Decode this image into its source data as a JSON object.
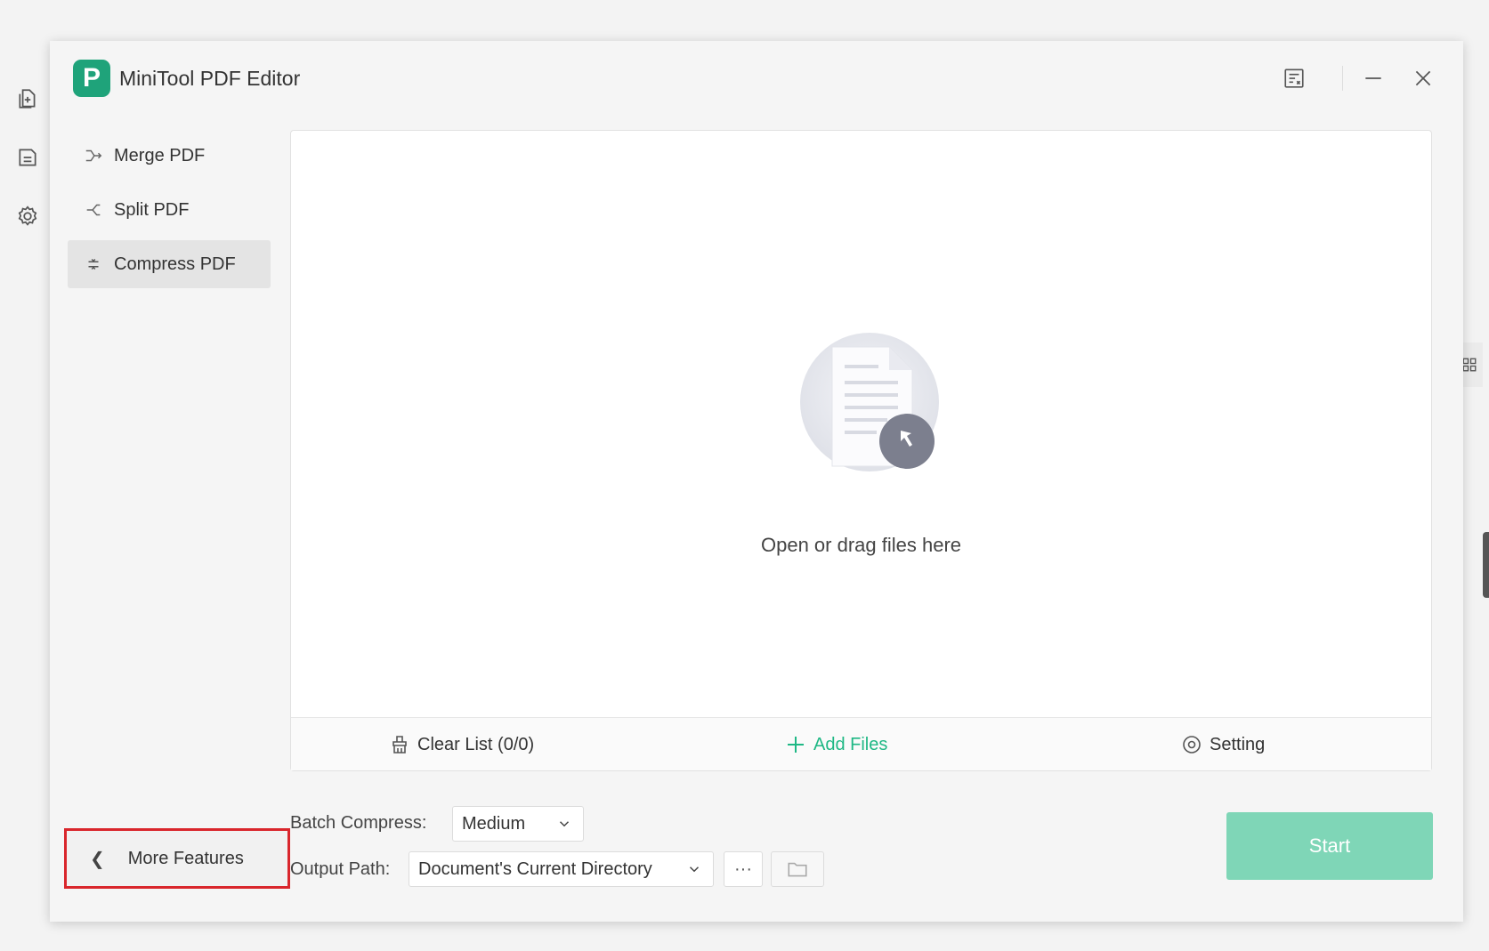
{
  "app": {
    "title": "MiniTool PDF Editor",
    "logo_letter": "P"
  },
  "rail": {
    "icons": [
      "new-file-icon",
      "folder-icon",
      "settings-icon"
    ]
  },
  "sidebar": {
    "items": [
      {
        "label": "Merge PDF",
        "icon": "merge-icon",
        "active": false
      },
      {
        "label": "Split PDF",
        "icon": "split-icon",
        "active": false
      },
      {
        "label": "Compress PDF",
        "icon": "compress-icon",
        "active": true
      }
    ],
    "more_features": "More Features"
  },
  "drop_zone": {
    "text": "Open or drag files here"
  },
  "panel_bar": {
    "clear_list": "Clear List (0/0)",
    "add_files": "Add Files",
    "setting": "Setting"
  },
  "options": {
    "batch_compress_label": "Batch Compress:",
    "batch_compress_value": "Medium",
    "output_path_label": "Output Path:",
    "output_path_value": "Document's Current Directory",
    "more_button": "···"
  },
  "start_button": "Start",
  "colors": {
    "accent": "#1fb885",
    "logo": "#1fa37a",
    "start_disabled": "#7fd6b7",
    "highlight": "#d9262c"
  }
}
